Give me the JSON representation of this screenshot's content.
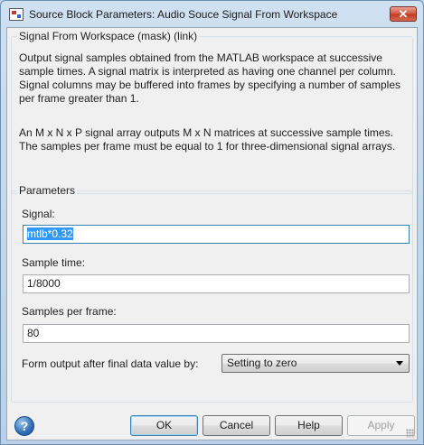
{
  "window": {
    "title": "Source Block Parameters: Audio Souce Signal From Workspace",
    "close_glyph": "✕"
  },
  "description": {
    "header": "Signal From Workspace (mask) (link)",
    "paragraph1": "Output signal samples obtained from the MATLAB workspace at successive sample times.  A signal matrix is interpreted as having one channel per column.  Signal columns may be buffered into frames by specifying a number of samples per frame greater than 1.",
    "paragraph2": "An M x N x P signal array outputs M x N matrices at successive sample times.  The samples per frame must be equal to 1 for three-dimensional signal arrays."
  },
  "parameters": {
    "header": "Parameters",
    "signal_label": "Signal:",
    "signal_value": "mtlb*0.32",
    "sample_time_label": "Sample time:",
    "sample_time_value": "1/8000",
    "samples_per_frame_label": "Samples per frame:",
    "samples_per_frame_value": "80",
    "form_output_label": "Form output after final data value by:",
    "form_output_value": "Setting to zero"
  },
  "buttons": {
    "ok": "OK",
    "cancel": "Cancel",
    "help": "Help",
    "apply": "Apply",
    "help_glyph": "?"
  }
}
